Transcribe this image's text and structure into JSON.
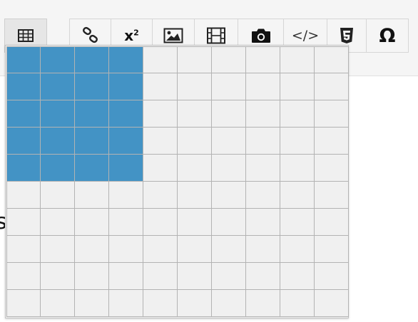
{
  "toolbar": {
    "buttons": [
      {
        "name": "insert-table-button",
        "icon": "table-icon",
        "active": true
      },
      {
        "name": "insert-link-button",
        "icon": "link-icon"
      },
      {
        "name": "superscript-button",
        "icon": "superscript-icon",
        "label": "x",
        "sup": "2"
      },
      {
        "name": "insert-image-button",
        "icon": "image-icon"
      },
      {
        "name": "insert-video-button",
        "icon": "film-icon"
      },
      {
        "name": "insert-photo-button",
        "icon": "camera-icon"
      },
      {
        "name": "code-view-button",
        "icon": "code-icon",
        "label": "</>"
      },
      {
        "name": "html5-button",
        "icon": "html5-icon"
      },
      {
        "name": "special-character-button",
        "icon": "omega-icon",
        "label": "Ω"
      }
    ]
  },
  "table_picker": {
    "rows": 10,
    "columns": 10,
    "selected_rows": 5,
    "selected_columns": 4,
    "cell_color": "#f0f0f0",
    "selected_color": "#4393c5"
  },
  "editor": {
    "partial_glyph": "s"
  }
}
